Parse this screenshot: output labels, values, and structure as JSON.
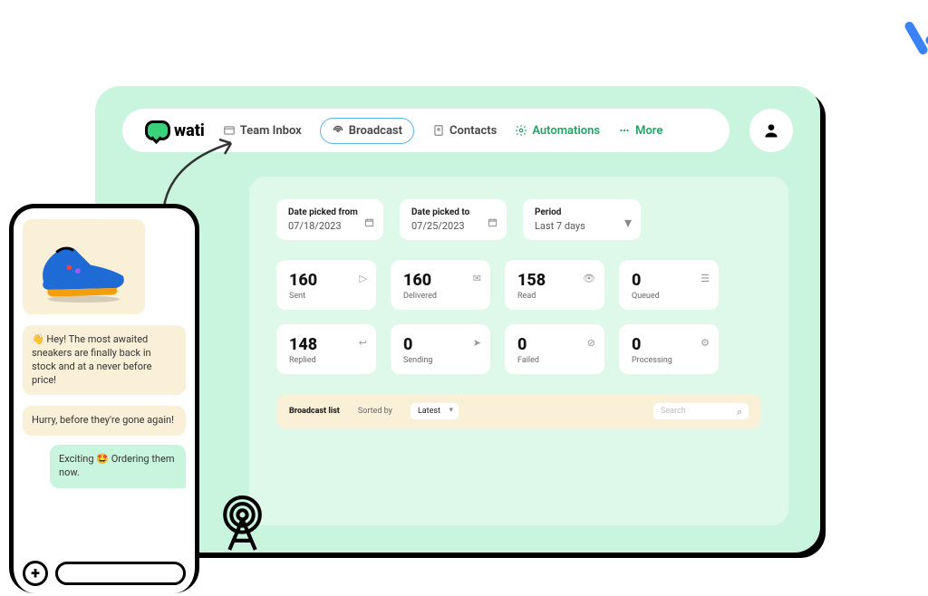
{
  "brand": "wati",
  "nav": {
    "team_inbox": "Team Inbox",
    "broadcast": "Broadcast",
    "contacts": "Contacts",
    "automations": "Automations",
    "more": "More"
  },
  "filters": {
    "from_label": "Date picked from",
    "from_value": "07/18/2023",
    "to_label": "Date picked to",
    "to_value": "07/25/2023",
    "period_label": "Period",
    "period_value": "Last 7 days"
  },
  "stats": [
    {
      "value": "160",
      "label": "Sent"
    },
    {
      "value": "160",
      "label": "Delivered"
    },
    {
      "value": "158",
      "label": "Read"
    },
    {
      "value": "0",
      "label": "Queued"
    },
    {
      "value": "148",
      "label": "Replied"
    },
    {
      "value": "0",
      "label": "Sending"
    },
    {
      "value": "0",
      "label": "Failed"
    },
    {
      "value": "0",
      "label": "Processing"
    }
  ],
  "broadcast_list": {
    "title": "Broadcast list",
    "sort_label": "Sorted by",
    "sort_value": "Latest",
    "search_placeholder": "Search"
  },
  "phone": {
    "msg1": "👋 Hey! The most awaited sneakers are finally back in stock and at a never before price!",
    "msg2": "Hurry, before they're gone again!",
    "reply": "Exciting 🤩 Ordering them now."
  }
}
